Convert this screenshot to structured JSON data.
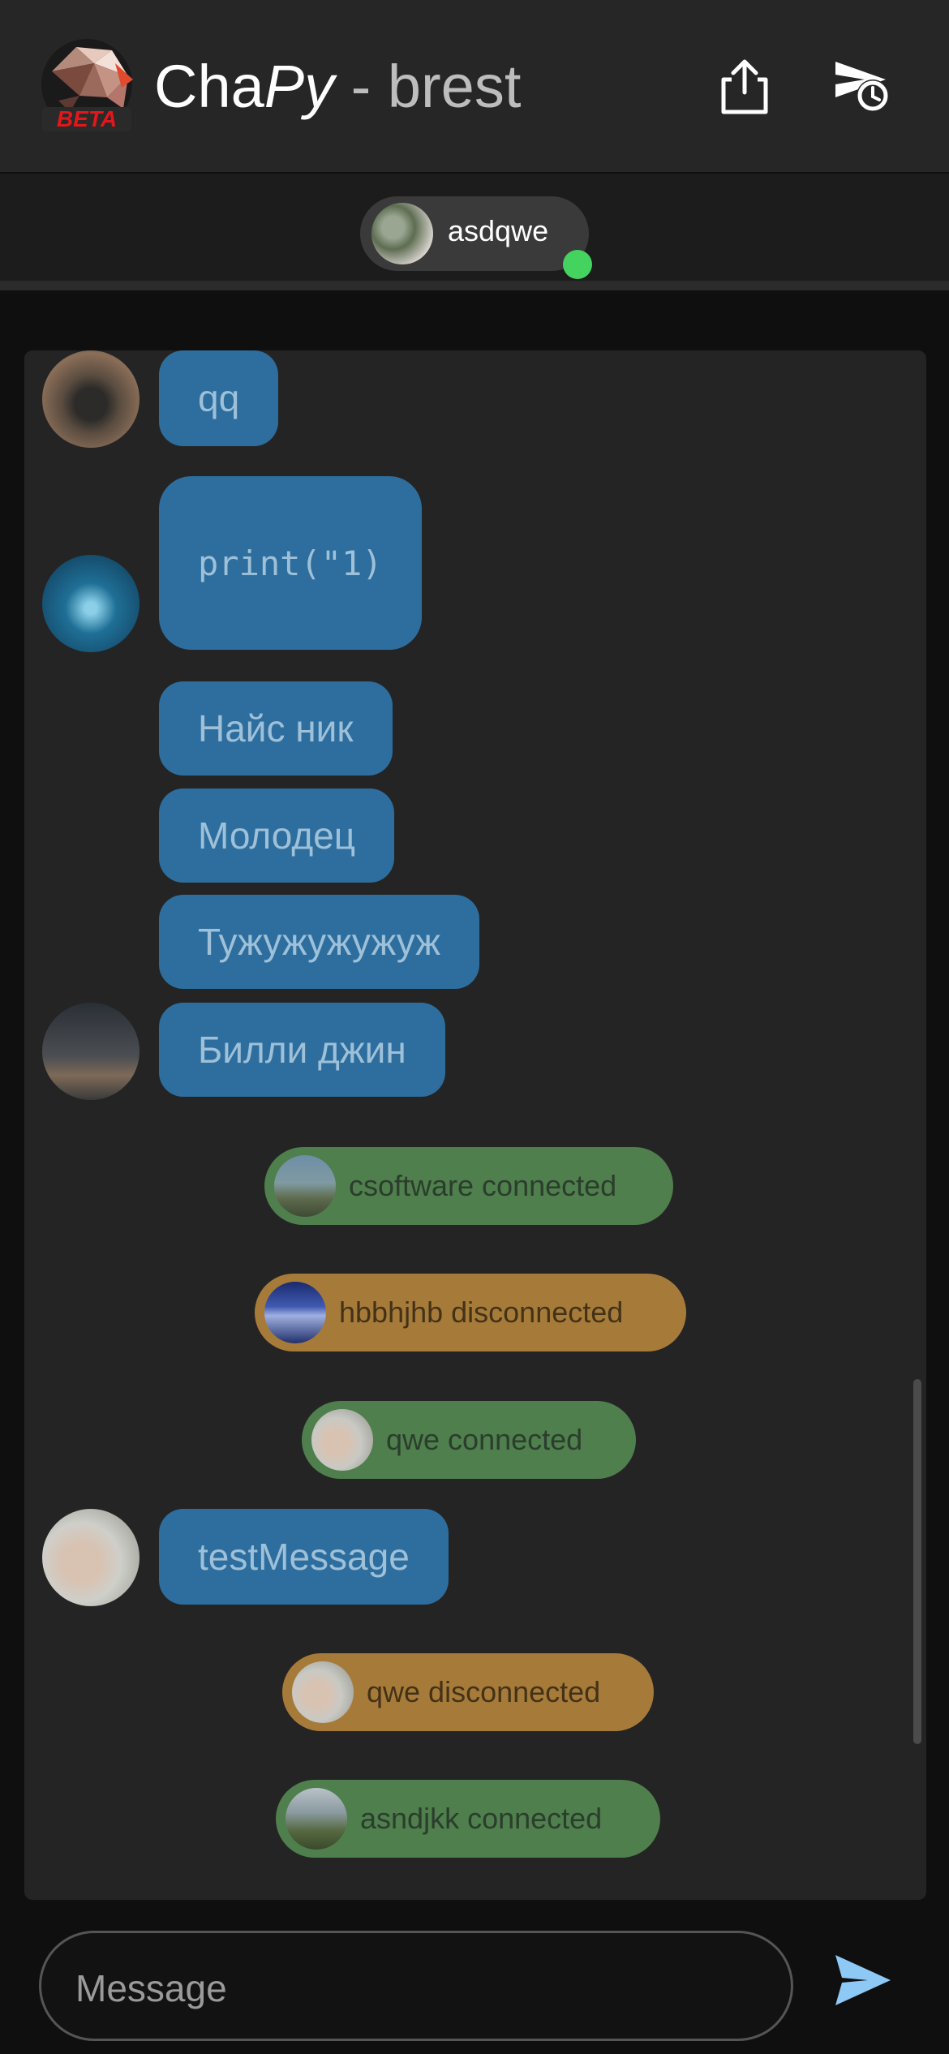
{
  "header": {
    "app_name_cha": "Cha",
    "app_name_py": "Py",
    "room": " - brest",
    "logo_badge": "BETA",
    "share_icon": "share-icon",
    "history_icon": "send-clock-icon"
  },
  "online_users": [
    {
      "name": "asdqwe",
      "status": "online"
    }
  ],
  "messages": [
    {
      "type": "message",
      "text": "qq"
    },
    {
      "type": "message",
      "text": "print(\"1)"
    },
    {
      "type": "message",
      "text": "Найс ник"
    },
    {
      "type": "message",
      "text": "Молодец"
    },
    {
      "type": "message",
      "text": "Тужужужужуж"
    },
    {
      "type": "message",
      "text": "Билли джин"
    },
    {
      "type": "status",
      "text": "csoftware connected",
      "kind": "connected"
    },
    {
      "type": "status",
      "text": "hbbhjhb disconnected",
      "kind": "disconnected"
    },
    {
      "type": "status",
      "text": "qwe connected",
      "kind": "connected"
    },
    {
      "type": "message",
      "text": "testMessage"
    },
    {
      "type": "status",
      "text": "qwe disconnected",
      "kind": "disconnected"
    },
    {
      "type": "status",
      "text": "asndjkk connected",
      "kind": "connected"
    }
  ],
  "composer": {
    "placeholder": "Message",
    "send_icon": "send-icon"
  },
  "colors": {
    "header_bg": "#262626",
    "bubble_bg": "#2d6e9e",
    "connected_bg": "#4f7f4d",
    "disconnected_bg": "#a67b3a",
    "online_dot": "#44d35f",
    "send_icon": "#8ec8f4"
  }
}
